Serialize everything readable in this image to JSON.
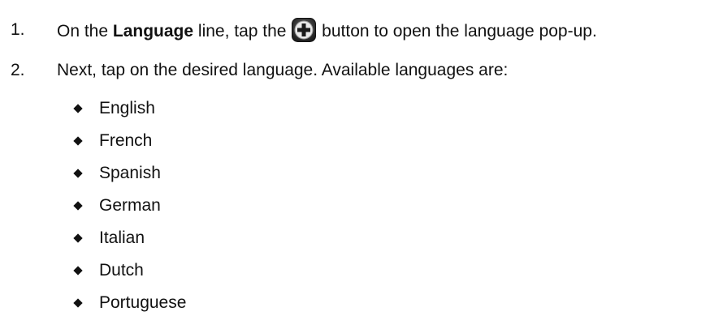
{
  "steps": [
    {
      "number": "1.",
      "text_before": "On the ",
      "bold_text": "Language",
      "text_middle": " line, tap the ",
      "icon": "plus-circle-icon",
      "text_after": " button to open the language pop-up."
    },
    {
      "number": "2.",
      "text": "Next, tap on the desired language.  Available languages are:"
    }
  ],
  "languages": [
    "English",
    "French",
    "Spanish",
    "German",
    "Italian",
    "Dutch",
    "Portuguese"
  ]
}
